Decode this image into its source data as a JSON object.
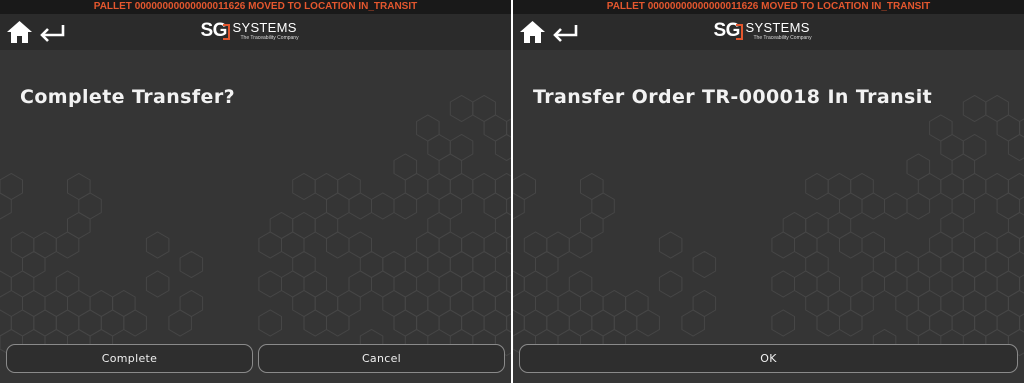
{
  "status_message": "PALLET 00000000000000011626 MOVED TO LOCATION IN_TRANSIT",
  "logo": {
    "sg": "SG",
    "systems": "SYSTEMS",
    "tagline": "The Traceability Company"
  },
  "left_screen": {
    "prompt": "Complete Transfer?",
    "buttons": {
      "complete": "Complete",
      "cancel": "Cancel"
    }
  },
  "right_screen": {
    "prompt": "Transfer Order TR-000018 In Transit",
    "buttons": {
      "ok": "OK"
    }
  },
  "colors": {
    "status_text": "#e4572e",
    "background": "#353535",
    "nav_background": "#2b2b2b",
    "logo_accent": "#e4572e"
  },
  "icons": {
    "home": "home-icon",
    "back": "back-arrow-icon"
  }
}
